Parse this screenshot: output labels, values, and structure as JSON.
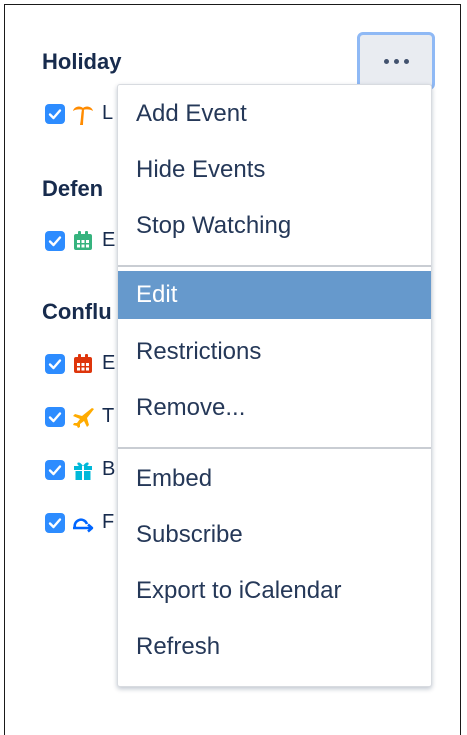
{
  "sections": [
    {
      "title": "Holiday",
      "calendars": [
        {
          "label": "L",
          "icon": "palm-tree-icon",
          "color": "#ff8b00",
          "checked": true
        }
      ]
    },
    {
      "title": "Defen",
      "calendars": [
        {
          "label": "E",
          "icon": "calendar-icon",
          "color": "#36b37e",
          "checked": true
        }
      ]
    },
    {
      "title": "Conflu",
      "calendars": [
        {
          "label": "E",
          "icon": "calendar-icon",
          "color": "#de350b",
          "checked": true
        },
        {
          "label": "T",
          "icon": "airplane-icon",
          "color": "#ffab00",
          "checked": true
        },
        {
          "label": "B",
          "icon": "gift-icon",
          "color": "#00b8d9",
          "checked": true
        },
        {
          "label": "F",
          "icon": "repeat-icon",
          "color": "#0065ff",
          "checked": true
        }
      ]
    }
  ],
  "more_button": {
    "icon": "more-dots-icon"
  },
  "menu": {
    "groups": [
      [
        "Add Event",
        "Hide Events",
        "Stop Watching"
      ],
      [
        "Edit",
        "Restrictions",
        "Remove..."
      ],
      [
        "Embed",
        "Subscribe",
        "Export to iCalendar",
        "Refresh"
      ]
    ],
    "active_item": "Edit"
  },
  "colors": {
    "checkbox": "#2d8cff",
    "menu_active_bg": "#6699cc",
    "heading_text": "#172b4d"
  }
}
